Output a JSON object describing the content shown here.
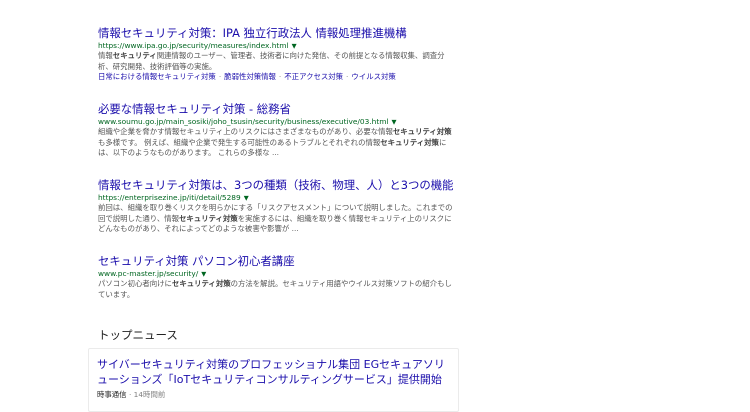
{
  "results": [
    {
      "title": "情報セキュリティ対策：IPA 独立行政法人 情報処理推進機構",
      "url": "https://www.ipa.go.jp/security/measures/index.html",
      "snippet_parts": [
        {
          "t": "情報"
        },
        {
          "t": "セキュリティ",
          "b": true
        },
        {
          "t": "関連情報のユーザー、管理者、技術者に向けた発信、その前提となる情報収集、調査分析、研究開発、技術評価等の実施。"
        }
      ],
      "sitelinks": [
        "日常における情報セキュリティ対策",
        "脆弱性対策情報",
        "不正アクセス対策",
        "ウイルス対策"
      ]
    },
    {
      "title": "必要な情報セキュリティ対策 - 総務省",
      "url": "www.soumu.go.jp/main_sosiki/joho_tsusin/security/business/executive/03.html",
      "snippet_parts": [
        {
          "t": "組織や企業を脅かす情報セキュリティ上のリスクにはさまざまなものがあり、必要な情報"
        },
        {
          "t": "セキュリティ対策",
          "b": true
        },
        {
          "t": "も多様です。 例えば、組織や企業で発生する可能性のあるトラブルとそれぞれの情報"
        },
        {
          "t": "セキュリティ対策",
          "b": true
        },
        {
          "t": "には、以下のようなものがあります。 これらの多様な ..."
        }
      ],
      "sitelinks": []
    },
    {
      "title": "情報セキュリティ対策は、3つの種類（技術、物理、人）と3つの機能（...",
      "url": "https://enterprisezine.jp/iti/detail/5289",
      "snippet_parts": [
        {
          "t": "前回は、組織を取り巻くリスクを明らかにする「リスクアセスメント」について説明しました。これまでの回で説明した通り、情報"
        },
        {
          "t": "セキュリティ対策",
          "b": true
        },
        {
          "t": "を実施するには、組織を取り巻く情報セキュリティ上のリスクにどんなものがあり、それによってどのような被害や影響が ..."
        }
      ],
      "sitelinks": []
    },
    {
      "title": "セキュリティ対策 パソコン初心者講座",
      "url": "www.pc-master.jp/security/",
      "snippet_parts": [
        {
          "t": "パソコン初心者向けに"
        },
        {
          "t": "セキュリティ対策",
          "b": true
        },
        {
          "t": "の方法を解説。セキュリティ用語やウイルス対策ソフトの紹介もしています。"
        }
      ],
      "sitelinks": []
    }
  ],
  "top_news": {
    "heading": "トップニュース",
    "title": "サイバーセキュリティ対策のプロフェッショナル集団 EGセキュアソリューションズ「IoTセキュリティコンサルティングサービス」提供開始",
    "source": "時事通信",
    "time": "14時間前"
  },
  "icons": {
    "url_caret": "▼",
    "meta_sep": "·"
  }
}
